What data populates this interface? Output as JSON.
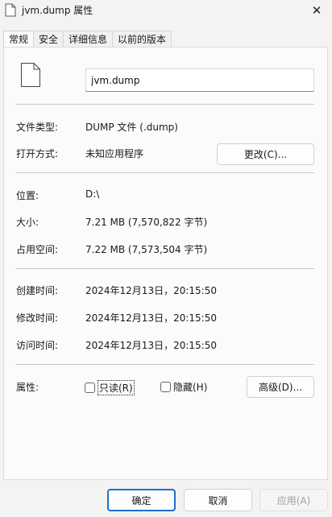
{
  "window": {
    "title": "jvm.dump 属性",
    "close_label": "✕"
  },
  "tabs": [
    {
      "label": "常规",
      "active": true
    },
    {
      "label": "安全",
      "active": false
    },
    {
      "label": "详细信息",
      "active": false
    },
    {
      "label": "以前的版本",
      "active": false
    }
  ],
  "general": {
    "file_name": "jvm.dump",
    "file_type_label": "文件类型:",
    "file_type_value": "DUMP 文件 (.dump)",
    "open_with_label": "打开方式:",
    "open_with_value": "未知应用程序",
    "change_button": "更改(C)...",
    "location_label": "位置:",
    "location_value": "D:\\",
    "size_label": "大小:",
    "size_value": "7.21 MB (7,570,822 字节)",
    "size_on_disk_label": "占用空间:",
    "size_on_disk_value": "7.22 MB (7,573,504 字节)",
    "created_label": "创建时间:",
    "created_value": "2024年12月13日，20:15:50",
    "modified_label": "修改时间:",
    "modified_value": "2024年12月13日，20:15:50",
    "accessed_label": "访问时间:",
    "accessed_value": "2024年12月13日，20:15:50",
    "attributes_label": "属性:",
    "readonly_label": "只读(R)",
    "readonly_checked": false,
    "hidden_label": "隐藏(H)",
    "hidden_checked": false,
    "advanced_button": "高级(D)..."
  },
  "footer": {
    "ok": "确定",
    "cancel": "取消",
    "apply": "应用(A)"
  },
  "colors": {
    "accent": "#1f6fd1",
    "background": "#f3f3f3",
    "panel": "#fbfbfb"
  },
  "icons": [
    "file-icon",
    "close-icon"
  ]
}
